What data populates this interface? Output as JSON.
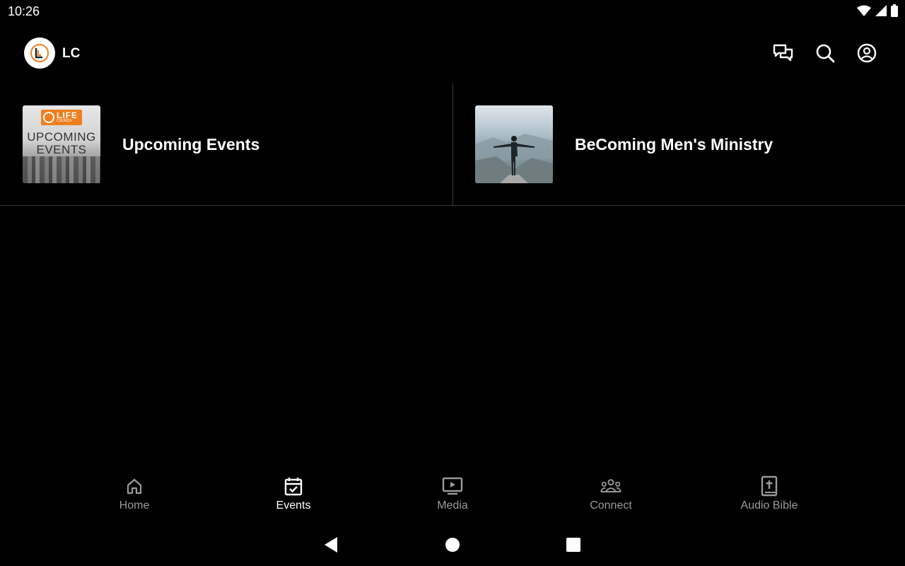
{
  "status_bar": {
    "time": "10:26"
  },
  "app_bar": {
    "title": "LC"
  },
  "cards": [
    {
      "title": "Upcoming Events",
      "thumb_badge": "LIFE",
      "thumb_badge_sub": "CHURCH",
      "thumb_line1": "UPCOMING",
      "thumb_line2": "EVENTS"
    },
    {
      "title": "BeComing Men's Ministry"
    }
  ],
  "bottom_nav": [
    {
      "label": "Home",
      "icon": "home-icon",
      "active": false
    },
    {
      "label": "Events",
      "icon": "calendar-check-icon",
      "active": true
    },
    {
      "label": "Media",
      "icon": "play-screen-icon",
      "active": false
    },
    {
      "label": "Connect",
      "icon": "people-group-icon",
      "active": false
    },
    {
      "label": "Audio Bible",
      "icon": "bible-icon",
      "active": false
    }
  ],
  "colors": {
    "background": "#000000",
    "accent": "#f07e1e",
    "inactive": "#9a9a9a",
    "divider": "#3a3a3a"
  }
}
